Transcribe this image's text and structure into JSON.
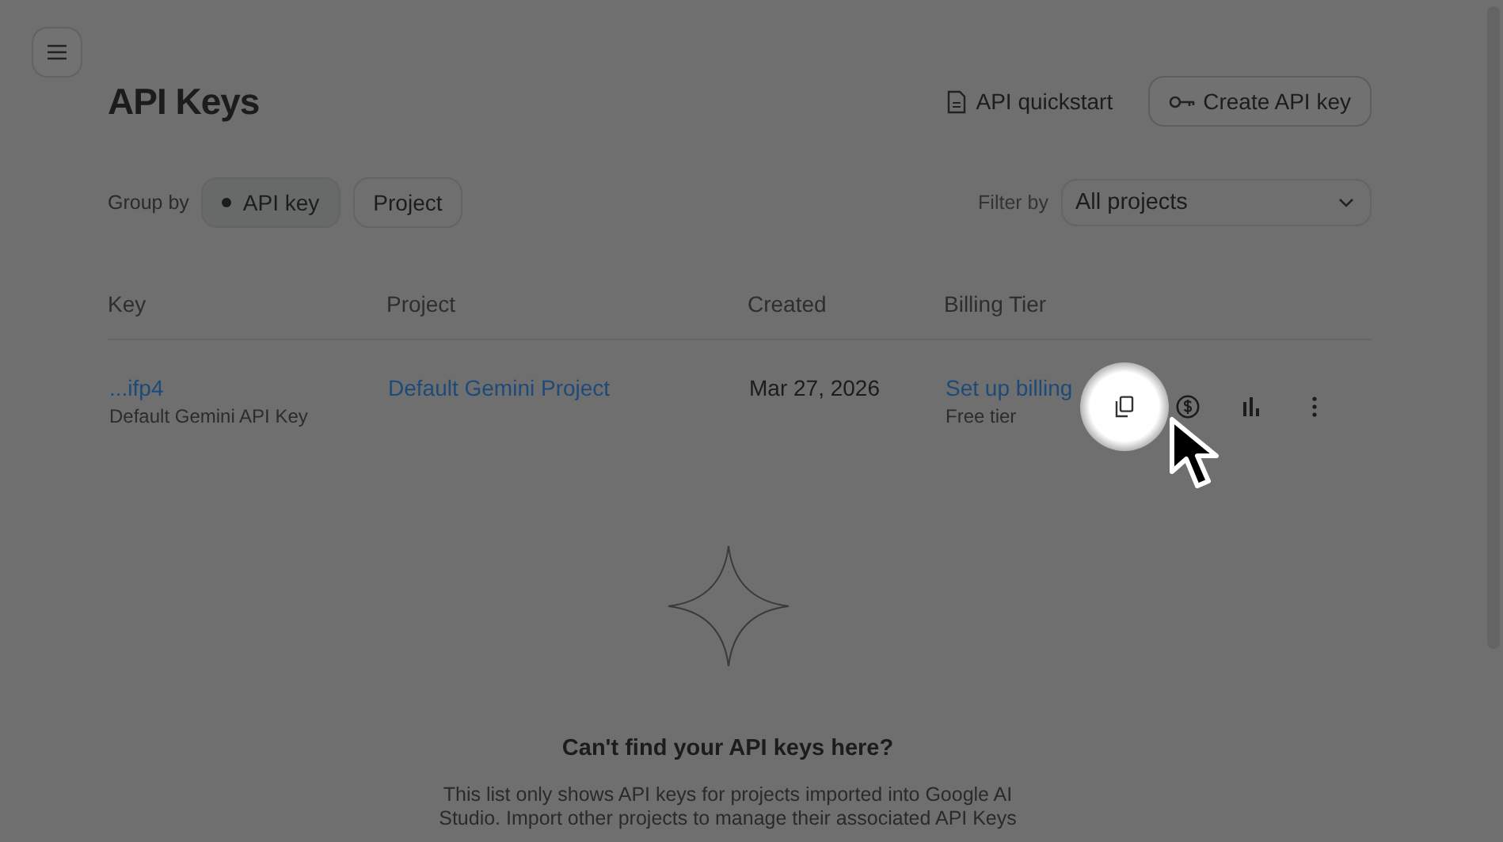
{
  "header": {
    "title": "API Keys",
    "quickstart": "API quickstart",
    "create_button": "Create API key"
  },
  "group_by": {
    "label": "Group by",
    "options": [
      {
        "label": "API key",
        "selected": true
      },
      {
        "label": "Project",
        "selected": false
      }
    ]
  },
  "filter": {
    "label": "Filter by",
    "value": "All projects"
  },
  "table": {
    "columns": [
      "Key",
      "Project",
      "Created",
      "Billing Tier"
    ],
    "rows": [
      {
        "key": "...ifp4",
        "key_name": "Default Gemini API Key",
        "project": "Default Gemini Project",
        "created": "Mar 27, 2026",
        "billing_link": "Set up billing",
        "tier": "Free tier"
      }
    ]
  },
  "empty_state": {
    "heading": "Can't find your API keys here?",
    "text": "This list only shows API keys for projects imported into Google AI Studio. Import other projects to manage their associated API Keys"
  }
}
